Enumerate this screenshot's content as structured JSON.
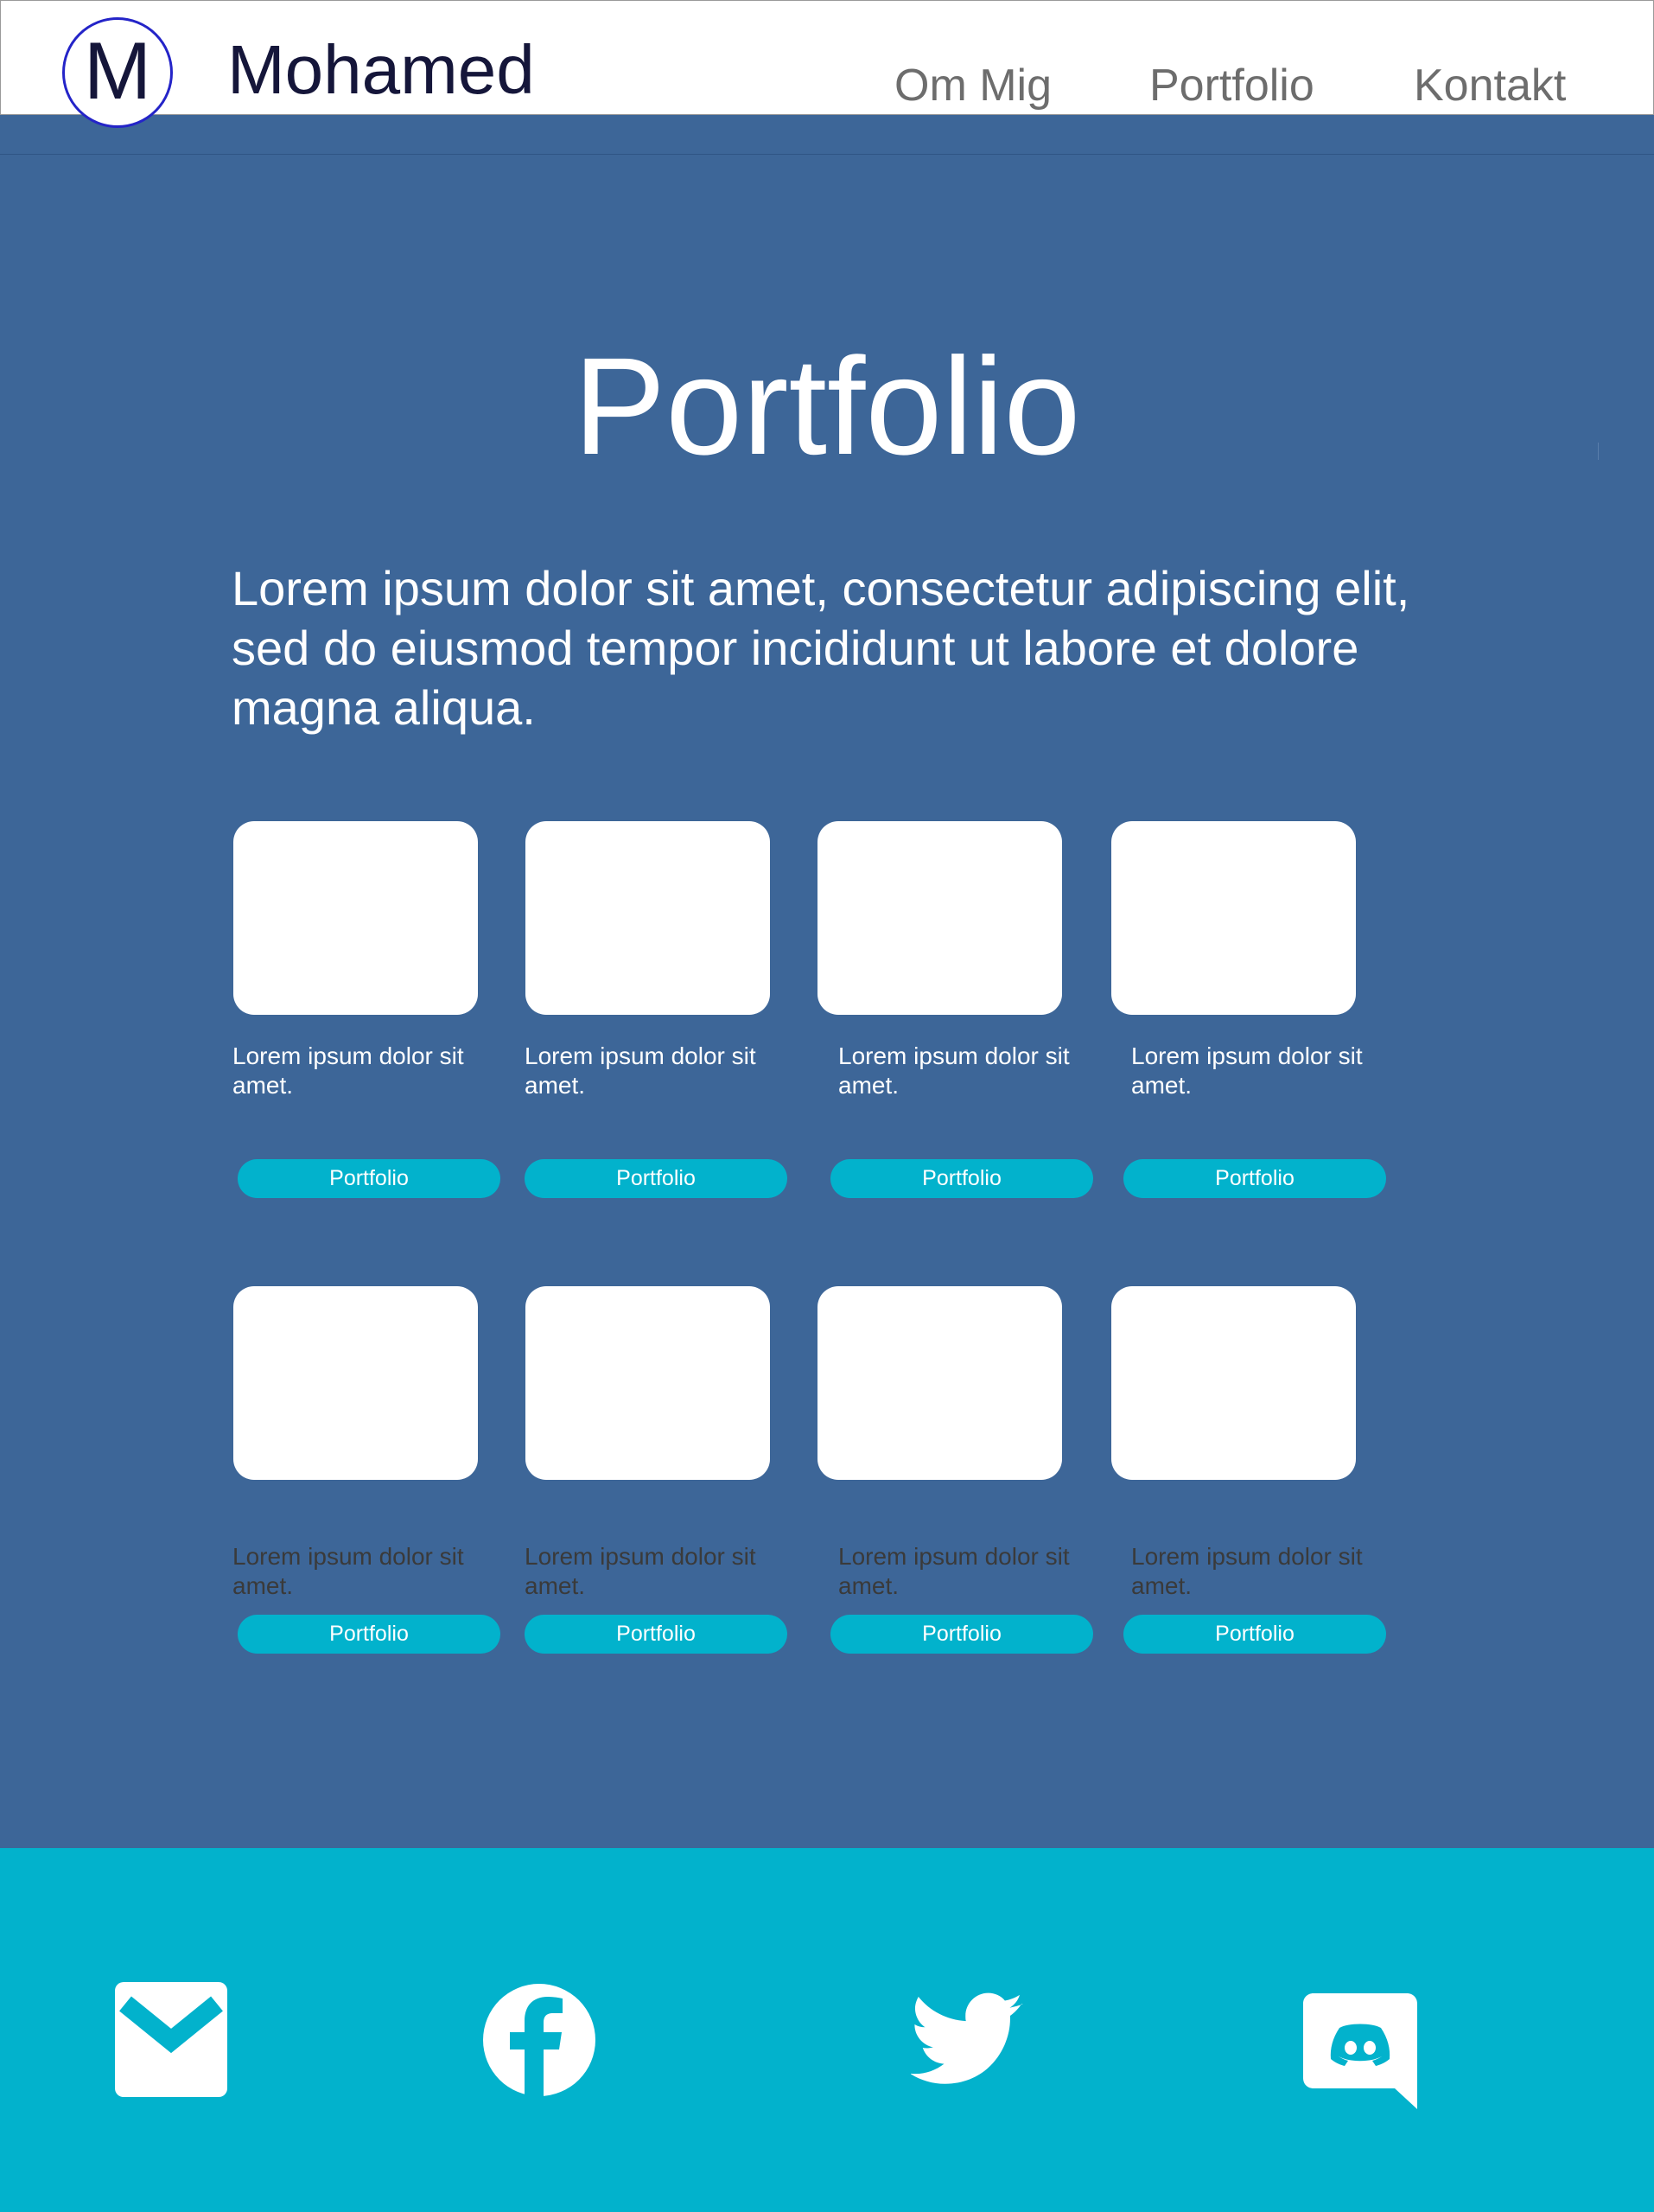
{
  "brand": {
    "logo_letter": "M",
    "name": "Mohamed"
  },
  "nav": {
    "items": [
      {
        "label": "Om Mig"
      },
      {
        "label": "Portfolio"
      },
      {
        "label": "Kontakt"
      }
    ]
  },
  "hero": {
    "title": "Portfolio",
    "intro": "Lorem ipsum dolor sit amet, consectetur adipiscing elit, sed do eiusmod tempor incididunt ut labore et dolore magna aliqua."
  },
  "portfolio": {
    "rows": [
      {
        "cards": [
          {
            "caption": "Lorem ipsum dolor sit amet.",
            "button_label": "Portfolio"
          },
          {
            "caption": "Lorem ipsum dolor sit amet.",
            "button_label": "Portfolio"
          },
          {
            "caption": "Lorem ipsum dolor sit amet.",
            "button_label": "Portfolio"
          },
          {
            "caption": "Lorem ipsum dolor sit amet.",
            "button_label": "Portfolio"
          }
        ]
      },
      {
        "cards": [
          {
            "caption": "Lorem ipsum dolor sit amet.",
            "button_label": "Portfolio"
          },
          {
            "caption": "Lorem ipsum dolor sit amet.",
            "button_label": "Portfolio"
          },
          {
            "caption": "Lorem ipsum dolor sit amet.",
            "button_label": "Portfolio"
          },
          {
            "caption": "Lorem ipsum dolor sit amet.",
            "button_label": "Portfolio"
          }
        ]
      }
    ]
  },
  "footer": {
    "social_icons": [
      {
        "icon": "mail-icon"
      },
      {
        "icon": "facebook-icon"
      },
      {
        "icon": "twitter-icon"
      },
      {
        "icon": "discord-icon"
      }
    ]
  },
  "colors": {
    "page_background": "#3d6698",
    "header_background": "#ffffff",
    "accent": "#02b2cc",
    "logo_ring": "#2424c8",
    "brand_text": "#15163a",
    "nav_text": "#6d6d6d",
    "caption_row1": "#ffffff",
    "caption_row2": "#3a3a3a"
  }
}
